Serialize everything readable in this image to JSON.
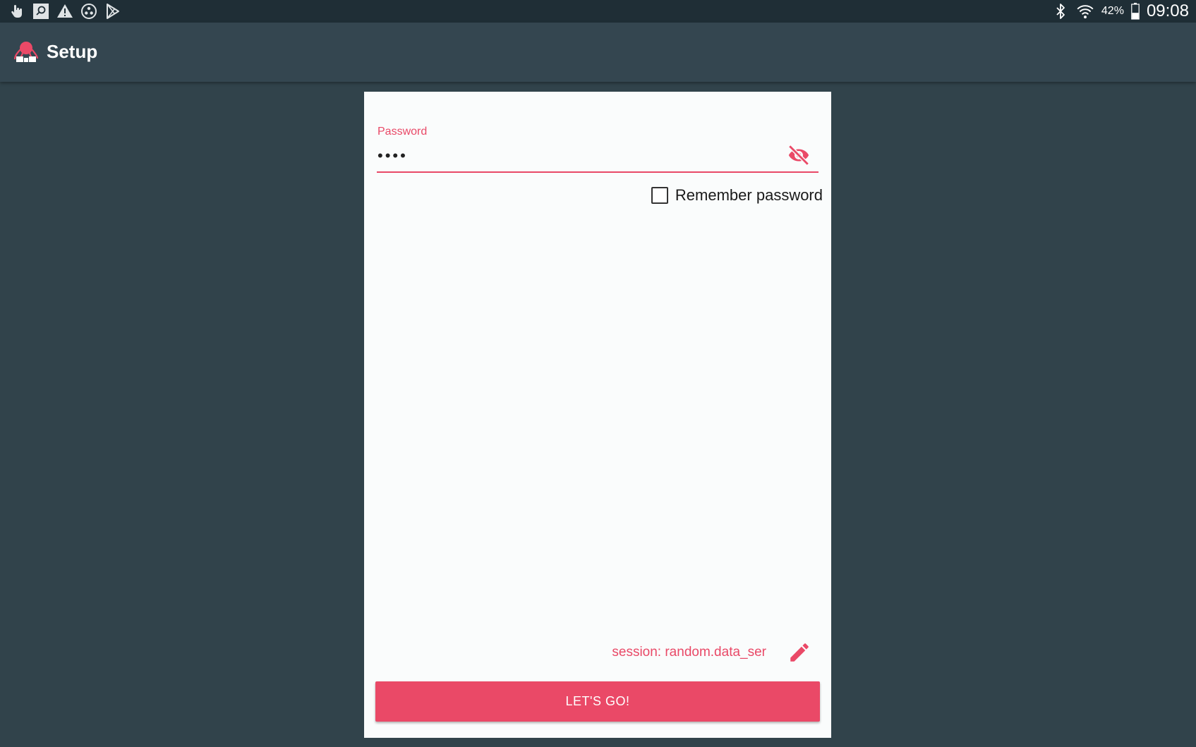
{
  "status_bar": {
    "icons_left": [
      "touch-icon",
      "screen-capture-icon",
      "warning-icon",
      "dots-circle-icon",
      "play-store-icon"
    ],
    "icons_right": [
      "bluetooth-icon",
      "wifi-icon",
      "battery-icon"
    ],
    "battery": "42%",
    "time": "09:08"
  },
  "app_bar": {
    "title": "Setup",
    "logo": "octopus-logo"
  },
  "form": {
    "password_label": "Password",
    "password_value": "••••",
    "toggle_icon": "visibility-off-icon",
    "remember_label": "Remember password",
    "remember_checked": false,
    "session_text": "session: random.data_ser",
    "edit_icon": "pencil-icon",
    "submit_label": "LET'S GO!"
  },
  "colors": {
    "accent": "#ea4967",
    "background": "#31434b",
    "app_bar": "#344650",
    "status_bar": "#1f2e36",
    "card": "#fafcfc"
  }
}
